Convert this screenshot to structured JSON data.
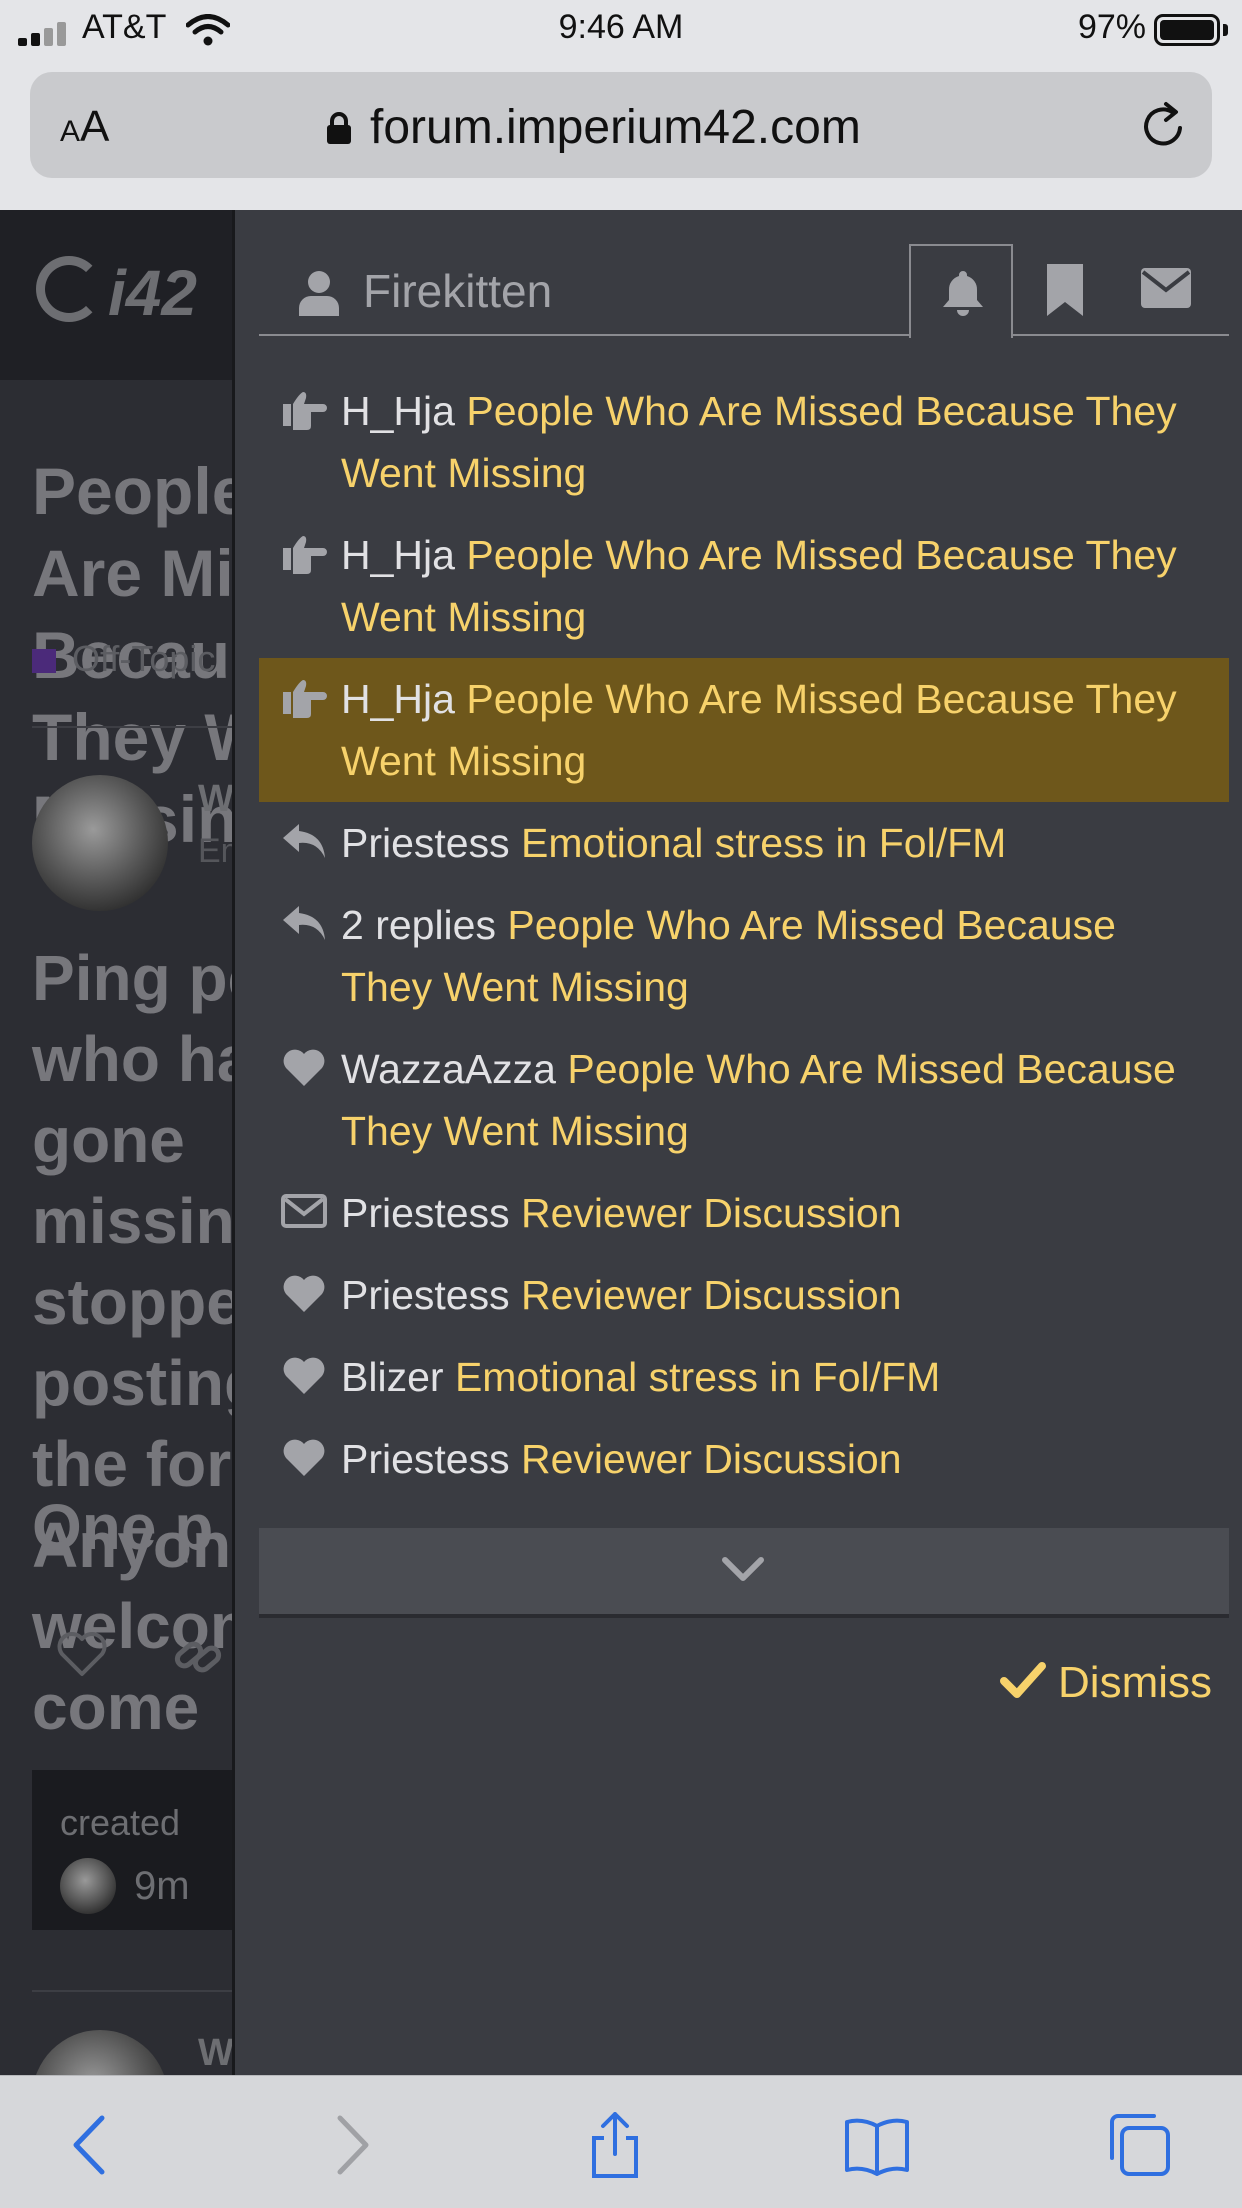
{
  "status_bar": {
    "carrier": "AT&T",
    "time": "9:46 AM",
    "battery_percent": "97%"
  },
  "browser": {
    "text_size_label_small": "A",
    "text_size_label_large": "A",
    "url": "forum.imperium42.com"
  },
  "background_page": {
    "logo_text": "i42",
    "topic_title": "People Who Are Missed Because They Went Missing",
    "category": "Off-Topic",
    "post_author": "WazzaAzza",
    "post_author_tag": "Em",
    "post_body": "Ping people who have gone missing, stopped posting on the forums. Anyone is welcome to come",
    "post_body_2": "One p",
    "created_label": "created",
    "created_ago": "9m",
    "second_author": "W"
  },
  "user_menu": {
    "username": "Firekitten",
    "active_tab": "notifications",
    "notifications": [
      {
        "icon": "hand-pointing-right-icon",
        "who": "H_Hja",
        "topic": "People Who Are Missed Because They Went Missing",
        "highlighted": false
      },
      {
        "icon": "hand-pointing-right-icon",
        "who": "H_Hja",
        "topic": "People Who Are Missed Because They Went Missing",
        "highlighted": false
      },
      {
        "icon": "hand-pointing-right-icon",
        "who": "H_Hja",
        "topic": "People Who Are Missed Because They Went Missing",
        "highlighted": true
      },
      {
        "icon": "reply-icon",
        "who": "Priestess",
        "topic": "Emotional stress in Fol/FM",
        "highlighted": false
      },
      {
        "icon": "reply-icon",
        "who": "2 replies",
        "topic": "People Who Are Missed Because They Went Missing",
        "highlighted": false
      },
      {
        "icon": "heart-icon",
        "who": "WazzaAzza",
        "topic": "People Who Are Missed Because They Went Missing",
        "highlighted": false
      },
      {
        "icon": "envelope-icon",
        "who": "Priestess",
        "topic": "Reviewer Discussion",
        "highlighted": false
      },
      {
        "icon": "heart-icon",
        "who": "Priestess",
        "topic": "Reviewer Discussion",
        "highlighted": false
      },
      {
        "icon": "heart-icon",
        "who": "Blizer",
        "topic": "Emotional stress in Fol/FM",
        "highlighted": false
      },
      {
        "icon": "heart-icon",
        "who": "Priestess",
        "topic": "Reviewer Discussion",
        "highlighted": false
      }
    ],
    "dismiss_label": "Dismiss"
  },
  "colors": {
    "accent": "#f7d26b",
    "highlight": "#6e571b",
    "panel": "#3a3c42",
    "ios_blue": "#2f6fe0"
  }
}
